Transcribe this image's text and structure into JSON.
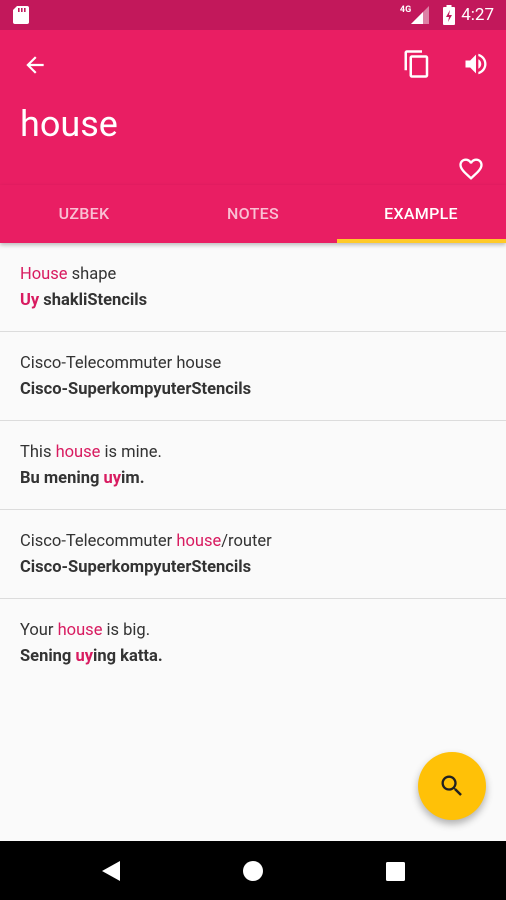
{
  "status_bar": {
    "network": "4G",
    "time": "4:27"
  },
  "toolbar": {
    "title": "house"
  },
  "tabs": [
    {
      "label": "UZBEK"
    },
    {
      "label": "NOTES"
    },
    {
      "label": "EXAMPLE"
    }
  ],
  "examples": [
    {
      "en": [
        {
          "t": "House",
          "h": true
        },
        {
          "t": " shape",
          "h": false
        }
      ],
      "uz": [
        {
          "t": "Uy",
          "h": true
        },
        {
          "t": " shakliStencils",
          "h": false
        }
      ]
    },
    {
      "en": [
        {
          "t": "Cisco-Telecommuter house",
          "h": false
        }
      ],
      "uz": [
        {
          "t": "Cisco-SuperkompyuterStencils",
          "h": false
        }
      ]
    },
    {
      "en": [
        {
          "t": "This ",
          "h": false
        },
        {
          "t": "house",
          "h": true
        },
        {
          "t": " is mine.",
          "h": false
        }
      ],
      "uz": [
        {
          "t": "Bu mening ",
          "h": false
        },
        {
          "t": "uy",
          "h": true
        },
        {
          "t": "im.",
          "h": false
        }
      ]
    },
    {
      "en": [
        {
          "t": "Cisco-Telecommuter ",
          "h": false
        },
        {
          "t": "house",
          "h": true
        },
        {
          "t": "/router",
          "h": false
        }
      ],
      "uz": [
        {
          "t": "Cisco-SuperkompyuterStencils",
          "h": false
        }
      ]
    },
    {
      "en": [
        {
          "t": "Your ",
          "h": false
        },
        {
          "t": "house",
          "h": true
        },
        {
          "t": " is big.",
          "h": false
        }
      ],
      "uz": [
        {
          "t": "Sening ",
          "h": false
        },
        {
          "t": "uy",
          "h": true
        },
        {
          "t": "ing katta.",
          "h": false
        }
      ]
    }
  ],
  "icons": {
    "back": "arrow-back-icon",
    "copy": "copy-icon",
    "speaker": "volume-icon",
    "favorite": "heart-outline-icon",
    "search": "search-icon"
  },
  "colors": {
    "primary": "#e91e63",
    "status_bar": "#c2185b",
    "accent": "#ffc107",
    "highlight": "#d81b60"
  }
}
